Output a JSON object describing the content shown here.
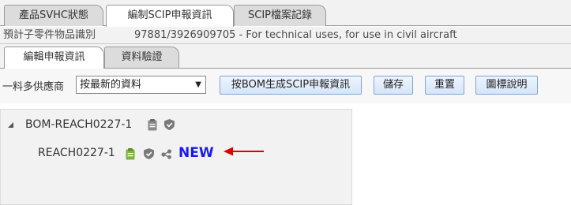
{
  "top_tabs": [
    "產品SVHC狀態",
    "編制SCIP申報資訊",
    "SCIP檔案記錄"
  ],
  "identification": {
    "label": "預計子零件物品識別",
    "value": "97881/3926909705 - For technical uses, for use in civil aircraft"
  },
  "sub_tabs": [
    "編輯申報資訊",
    "資料驗證"
  ],
  "toolbar": {
    "supplier_label": "一料多供應商",
    "supplier_select_value": "按最新的資料",
    "generate_button": "按BOM生成SCIP申報資訊",
    "save_button": "儲存",
    "reset_button": "重置",
    "legend_button": "圖標說明"
  },
  "tree": {
    "root_label": "BOM-REACH0227-1",
    "child_label": "REACH0227-1",
    "child_badge": "NEW"
  },
  "icons": [
    "expand-triangle-icon",
    "clipboard-icon",
    "shield-icon",
    "share-icon",
    "red-arrow-icon"
  ],
  "colors": {
    "new_badge": "#1a1aee",
    "arrow": "#e00000",
    "clipboard_green": "#7cb342",
    "clipboard_gray": "#8a8a8a"
  }
}
